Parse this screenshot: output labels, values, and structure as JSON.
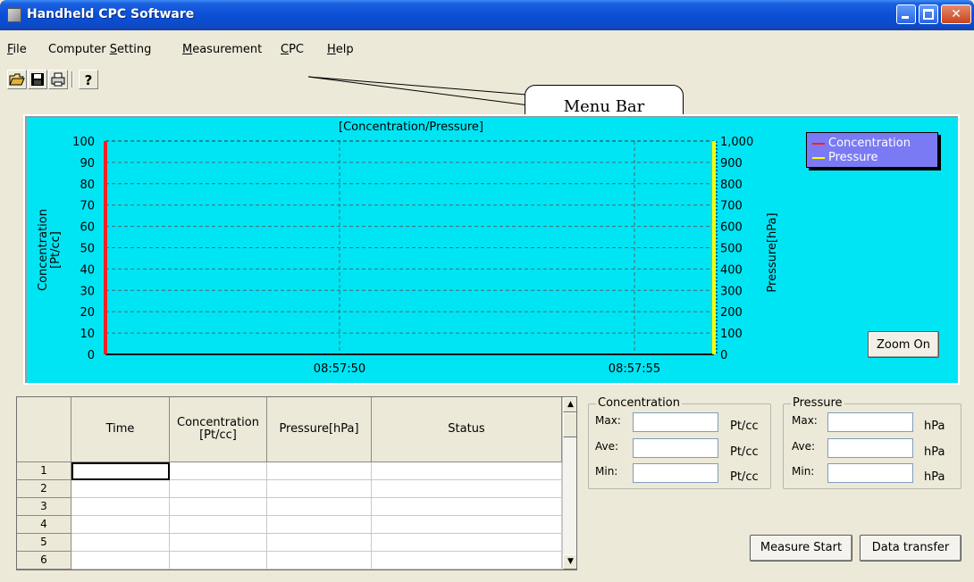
{
  "window": {
    "title": "Handheld CPC Software"
  },
  "menubar": {
    "items": [
      {
        "label": "File",
        "mnemonic": "F"
      },
      {
        "label": "Computer Setting",
        "mnemonic": "S"
      },
      {
        "label": "Measurement",
        "mnemonic": "M"
      },
      {
        "label": "CPC",
        "mnemonic": "C"
      },
      {
        "label": "Help",
        "mnemonic": "H"
      }
    ]
  },
  "toolbar": {
    "icons": [
      "open-folder-icon",
      "save-icon",
      "print-icon",
      "help-icon"
    ],
    "help_glyph": "?"
  },
  "callout": {
    "label": "Menu Bar"
  },
  "chart": {
    "title": "[Concentration/Pressure]",
    "ylabel_left": "Concentration\n[Pt/cc]",
    "ylabel_left_line1": "Concentration",
    "ylabel_left_line2": "[Pt/cc]",
    "ylabel_right": "Pressure[hPa]",
    "zoom_label": "Zoom On",
    "legend": [
      {
        "name": "Concentration",
        "color": "#ff2020"
      },
      {
        "name": "Pressure",
        "color": "#ffff00"
      }
    ],
    "background": "#00e5f4"
  },
  "chart_data": {
    "type": "line",
    "title": "[Concentration/Pressure]",
    "xlabel": "",
    "ylabel": "Concentration\n[Pt/cc]",
    "y2label": "Pressure[hPa]",
    "x_ticks": [
      "08:57:50",
      "08:57:55"
    ],
    "y_ticks_left": [
      0,
      10,
      20,
      30,
      40,
      50,
      60,
      70,
      80,
      90,
      100
    ],
    "y_ticks_right": [
      "0",
      "100",
      "200",
      "300",
      "400",
      "500",
      "600",
      "700",
      "800",
      "900",
      "1,000"
    ],
    "ylim": [
      0,
      100
    ],
    "y2lim": [
      0,
      1000
    ],
    "grid": true,
    "legend_position": "top-right",
    "series": [
      {
        "name": "Concentration",
        "axis": "left",
        "color": "#ff2020",
        "values": []
      },
      {
        "name": "Pressure",
        "axis": "right",
        "color": "#ffff00",
        "values": []
      }
    ]
  },
  "table": {
    "columns": [
      "Time",
      "Concentration\n[Pt/cc]",
      "Pressure[hPa]",
      "Status"
    ],
    "col_time": "Time",
    "col_conc_1": "Concentration",
    "col_conc_2": "[Pt/cc]",
    "col_pressure": "Pressure[hPa]",
    "col_status": "Status",
    "row_numbers": [
      "1",
      "2",
      "3",
      "4",
      "5",
      "6"
    ]
  },
  "stats": {
    "concentration": {
      "title": "Concentration",
      "max_label": "Max:",
      "ave_label": "Ave:",
      "min_label": "Min:",
      "unit": "Pt/cc",
      "max": "",
      "ave": "",
      "min": ""
    },
    "pressure": {
      "title": "Pressure",
      "max_label": "Max:",
      "ave_label": "Ave:",
      "min_label": "Min:",
      "unit": "hPa",
      "max": "",
      "ave": "",
      "min": ""
    }
  },
  "actions": {
    "measure_start": "Measure Start",
    "data_transfer": "Data transfer"
  }
}
